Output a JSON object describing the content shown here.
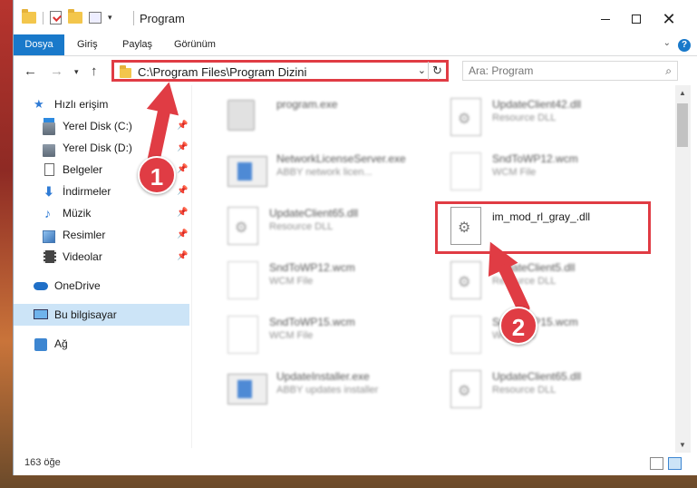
{
  "window": {
    "title": "Program",
    "minimize_icon": "minimize-icon",
    "maximize_icon": "maximize-icon",
    "close_icon": "close-icon"
  },
  "ribbon": {
    "tabs": [
      {
        "label": "Dosya"
      },
      {
        "label": "Giriş"
      },
      {
        "label": "Paylaş"
      },
      {
        "label": "Görünüm"
      }
    ],
    "accent": "#1979ca"
  },
  "address": {
    "path": "C:\\Program Files\\Program Dizini"
  },
  "search": {
    "placeholder": "Ara: Program"
  },
  "nav": {
    "items": [
      {
        "label": "Hızlı erişim",
        "icon": "star-icon"
      },
      {
        "label": "Yerel Disk (C:)",
        "icon": "disk-icon",
        "pinned": true
      },
      {
        "label": "Yerel Disk (D:)",
        "icon": "disk-icon",
        "pinned": true
      },
      {
        "label": "Belgeler",
        "icon": "document-icon",
        "pinned": true
      },
      {
        "label": "İndirmeler",
        "icon": "download-icon",
        "pinned": true
      },
      {
        "label": "Müzik",
        "icon": "music-icon",
        "pinned": true
      },
      {
        "label": "Resimler",
        "icon": "pictures-icon",
        "pinned": true
      },
      {
        "label": "Videolar",
        "icon": "video-icon",
        "pinned": true
      },
      {
        "label": "OneDrive",
        "icon": "cloud-icon"
      },
      {
        "label": "Bu bilgisayar",
        "icon": "computer-icon",
        "selected": true
      },
      {
        "label": "Ağ",
        "icon": "network-icon"
      }
    ],
    "selected_color": "#cce4f7"
  },
  "files": [
    {
      "name": "program.exe",
      "desc": ""
    },
    {
      "name": "UpdateClient42.dll",
      "desc": "Resource DLL"
    },
    {
      "name": "NetworkLicenseServer.exe",
      "desc": "ABBY network licen..."
    },
    {
      "name": "SndToWP12.wcm",
      "desc": "WCM File"
    },
    {
      "name": "UpdateClient65.dll",
      "desc": "Resource DLL"
    },
    {
      "name": "im_mod_rl_gray_.dll",
      "desc": ""
    },
    {
      "name": "SndToWP12.wcm",
      "desc": "WCM File"
    },
    {
      "name": "UpdateClient5.dll",
      "desc": "Resource DLL"
    },
    {
      "name": "SndToWP15.wcm",
      "desc": "WCM File"
    },
    {
      "name": "SndToWP15.wcm",
      "desc": "WCM File"
    },
    {
      "name": "UpdateInstaller.exe",
      "desc": "ABBY updates installer"
    },
    {
      "name": "UpdateClient65.dll",
      "desc": "Resource DLL"
    }
  ],
  "status": {
    "count": "163 öğe"
  },
  "annotations": {
    "step1": "1",
    "step2": "2",
    "color": "#e03c44"
  }
}
